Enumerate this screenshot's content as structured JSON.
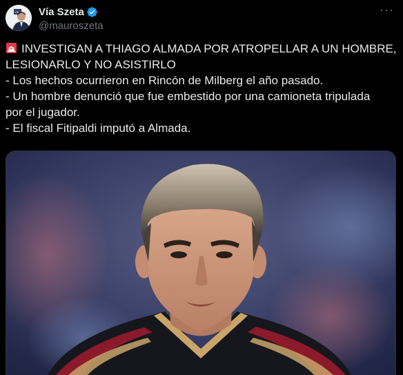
{
  "author": {
    "display_name": "Vía Szeta",
    "handle": "@mauroszeta",
    "avatar_icon": "profile-photo",
    "verified_icon": "verified-badge-icon",
    "verified_color": "#1d9bf0"
  },
  "menu": {
    "more_icon": "more-options-icon",
    "more_label": "···"
  },
  "tweet": {
    "lines": [
      "INVESTIGAN A THIAGO ALMADA POR ATROPELLAR A UN HOMBRE,",
      "LESIONARLO Y NO ASISTIRLO",
      "- Los hechos ocurrieron en Rincón de Milberg el año pasado.",
      "- Un hombre denunció que fue embestido por una camioneta tripulada",
      "por el jugador.",
      "- El fiscal Fitipaldi imputó a Almada."
    ],
    "emoji_icon": "police-siren-icon"
  },
  "media": {
    "icon": "photo-of-player",
    "colors": {
      "jersey_red": "#8b1a2b",
      "jersey_dark": "#16161d",
      "trim_gold": "#c9a56a",
      "background": "#2b3250"
    }
  },
  "theme": {
    "background": "#000000",
    "text": "#e7e9ea",
    "muted": "#71767b",
    "border": "#2f3336"
  }
}
